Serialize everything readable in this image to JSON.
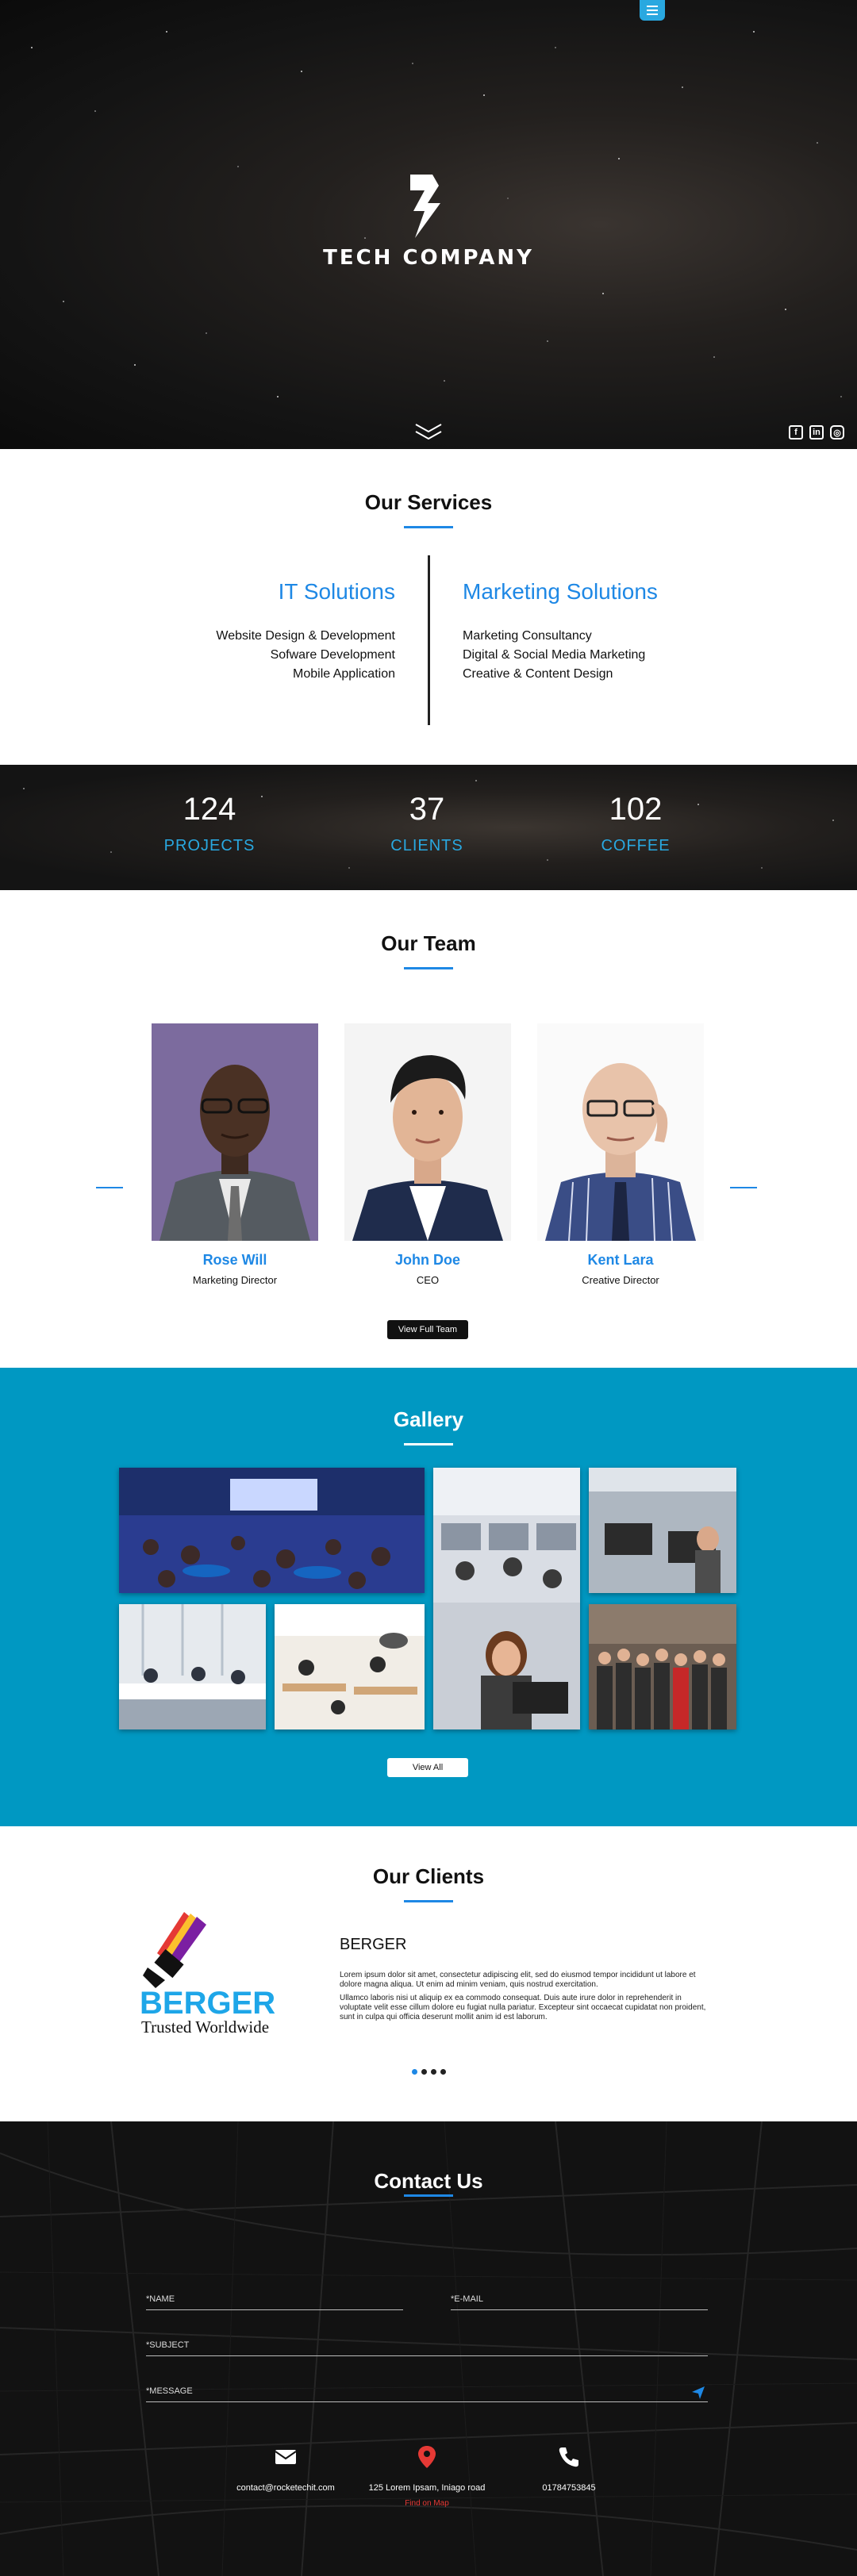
{
  "hero": {
    "brand": "TECH COMPANY",
    "menu_icon": "hamburger-icon",
    "scroll_icon": "double-chevron-down-icon",
    "socials": [
      {
        "icon": "facebook-icon",
        "glyph": "f"
      },
      {
        "icon": "linkedin-icon",
        "glyph": "in"
      },
      {
        "icon": "instagram-icon",
        "glyph": "◎"
      }
    ]
  },
  "services": {
    "title": "Our Services",
    "left": {
      "heading": "IT Solutions",
      "items": [
        "Website Design & Development",
        "Sofware Development",
        "Mobile Application"
      ]
    },
    "right": {
      "heading": "Marketing Solutions",
      "items": [
        "Marketing Consultancy",
        "Digital & Social Media Marketing",
        "Creative & Content Design"
      ]
    }
  },
  "stats": [
    {
      "value": "124",
      "label": "PROJECTS"
    },
    {
      "value": "37",
      "label": "CLIENTS"
    },
    {
      "value": "102",
      "label": "COFFEE"
    }
  ],
  "team": {
    "title": "Our Team",
    "members": [
      {
        "name": "Rose Will",
        "role": "Marketing Director"
      },
      {
        "name": "John Doe",
        "role": "CEO"
      },
      {
        "name": "Kent Lara",
        "role": "Creative Director"
      }
    ],
    "button": "View Full Team"
  },
  "gallery": {
    "title": "Gallery",
    "button": "View All"
  },
  "clients": {
    "title": "Our Clients",
    "name": "BERGER",
    "logo_text": "BERGER",
    "logo_tagline": "Trusted Worldwide",
    "para1": "Lorem ipsum dolor sit amet, consectetur adipiscing elit, sed do eiusmod tempor incididunt ut labore et dolore magna aliqua. Ut enim ad minim veniam, quis nostrud exercitation.",
    "para2": "Ullamco laboris nisi ut aliquip ex ea commodo consequat. Duis aute irure dolor in reprehenderit in voluptate velit esse cillum dolore eu fugiat nulla pariatur. Excepteur sint occaecat cupidatat non proident, sunt in culpa qui officia deserunt mollit anim id est laborum.",
    "slides": 4,
    "active_slide": 1
  },
  "contact": {
    "title": "Contact Us",
    "fields": {
      "name": "*NAME",
      "email": "*E-MAIL",
      "subject": "*SUBJECT",
      "message": "*MESSAGE"
    },
    "email": "contact@rocketechit.com",
    "address": "125 Lorem Ipsam, Iniago road",
    "map_link": "Find on Map",
    "phone": "01784753845"
  },
  "colors": {
    "accent": "#1E88E5",
    "gallery_bg": "#0098c2",
    "map_link": "#e53935"
  }
}
